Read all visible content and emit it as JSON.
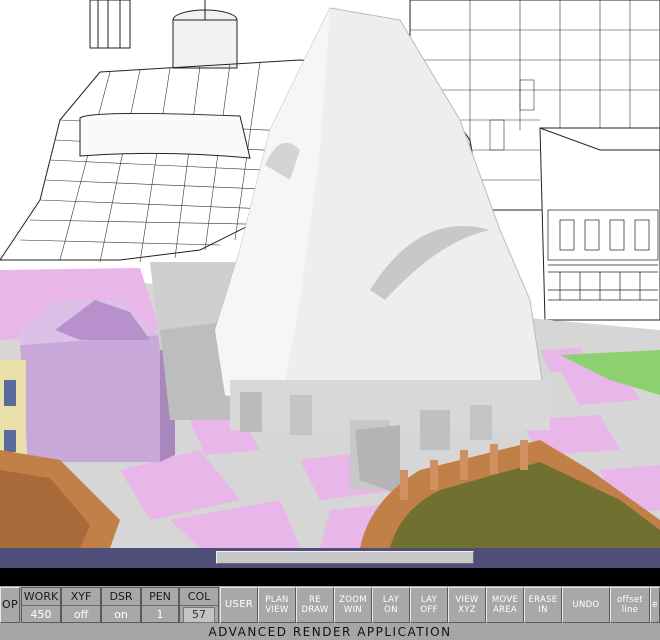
{
  "app": {
    "title": "ADVANCED RENDER APPLICATION"
  },
  "command_line": {
    "text": ""
  },
  "status": {
    "left_cut_label": "OP",
    "work": {
      "label": "WORK",
      "value": "450"
    },
    "xyf": {
      "label": "XYF",
      "value": "off"
    },
    "dsr": {
      "label": "DSR",
      "value": "on"
    },
    "pen": {
      "label": "PEN",
      "value": "1"
    },
    "col": {
      "label": "COL",
      "value": "57"
    }
  },
  "menu": {
    "user": "USER",
    "plan_view": [
      "PLAN",
      "VIEW"
    ],
    "redraw": [
      "RE",
      "DRAW"
    ],
    "zoom_win": [
      "ZOOM",
      "WIN"
    ],
    "lay_on": [
      "LAY",
      "ON"
    ],
    "lay_off": [
      "LAY",
      "OFF"
    ],
    "view_xyz": [
      "VIEW",
      "XYZ"
    ],
    "move_area": [
      "MOVE",
      "AREA"
    ],
    "erase_in": [
      "ERASE",
      "IN"
    ],
    "undo": "UNDO",
    "offset_line": [
      "offset",
      "line"
    ],
    "cut_right": "e"
  },
  "colors": {
    "scrollbar": "#4e4e78",
    "panel": "#a6a6a6",
    "roof": "#eeeeee",
    "pink_tile": "#e8b6e8",
    "green_lawn": "#8cd070",
    "purple_building": "#c8a8d8",
    "orange_wall": "#c08048"
  }
}
